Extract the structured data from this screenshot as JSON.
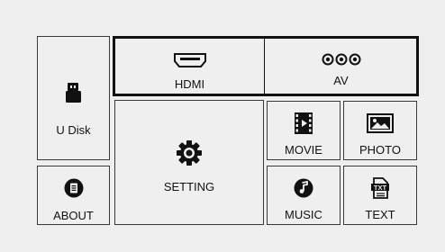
{
  "menu": {
    "u_disk": {
      "label": "U Disk",
      "icon": "usb-drive-icon"
    },
    "hdmi": {
      "label": "HDMI",
      "icon": "hdmi-port-icon",
      "selected": true
    },
    "av": {
      "label": "AV",
      "icon": "rca-connectors-icon"
    },
    "setting": {
      "label": "SETTING",
      "icon": "gear-icon"
    },
    "movie": {
      "label": "MOVIE",
      "icon": "film-icon"
    },
    "photo": {
      "label": "PHOTO",
      "icon": "image-icon"
    },
    "about": {
      "label": "ABOUT",
      "icon": "info-document-icon"
    },
    "music": {
      "label": "MUSIC",
      "icon": "music-note-icon"
    },
    "text": {
      "label": "TEXT",
      "icon": "txt-file-icon"
    }
  },
  "colors": {
    "background": "#efefef",
    "border": "#3a3a3a",
    "focus_border": "#111111",
    "icon": "#111111"
  }
}
